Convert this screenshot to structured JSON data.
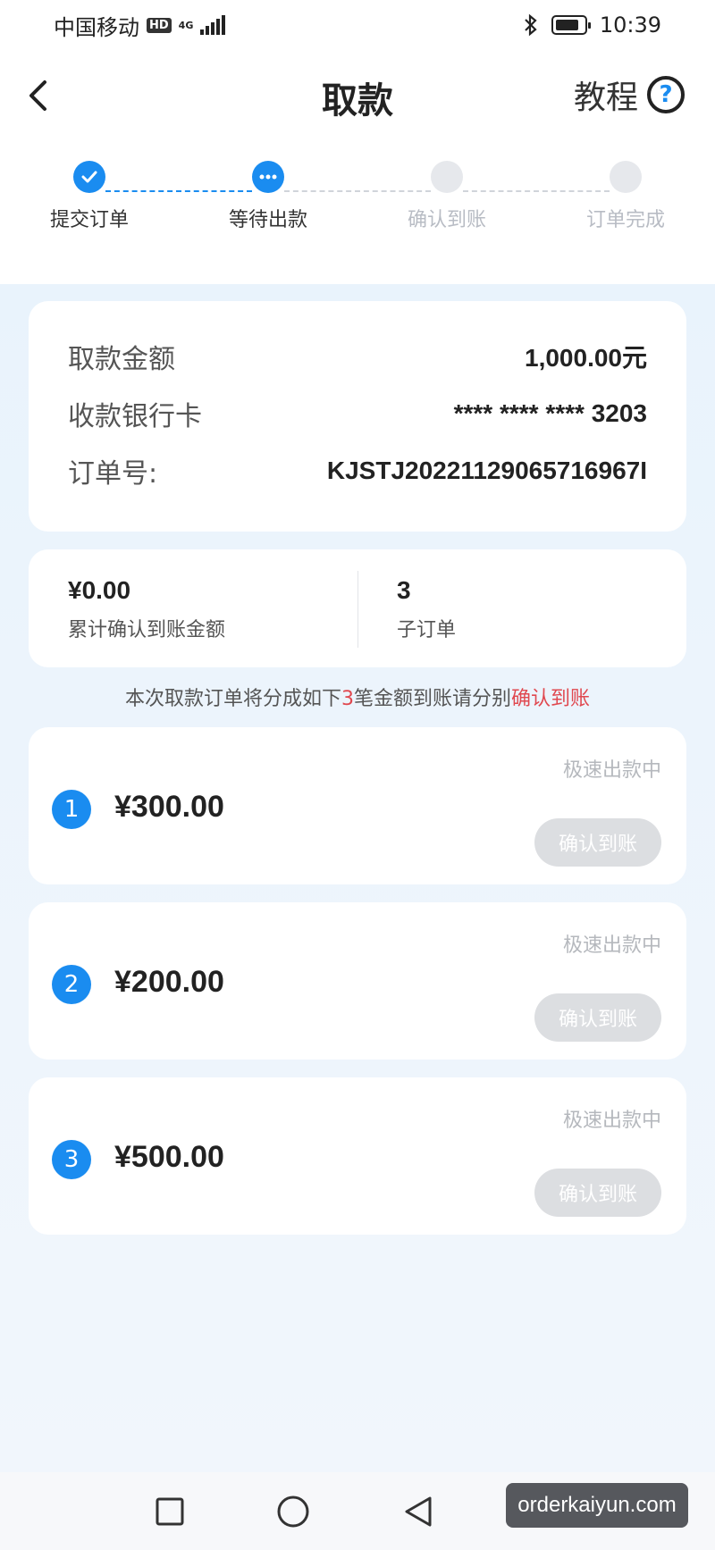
{
  "status_bar": {
    "carrier": "中国移动",
    "hd_badge": "HD",
    "network": "4G",
    "time": "10:39",
    "battery_level": 0.85
  },
  "header": {
    "title": "取款",
    "tutorial_label": "教程",
    "help_glyph": "?"
  },
  "steps": [
    {
      "label": "提交订单",
      "state": "done"
    },
    {
      "label": "等待出款",
      "state": "active"
    },
    {
      "label": "确认到账",
      "state": "todo"
    },
    {
      "label": "订单完成",
      "state": "todo"
    }
  ],
  "order_info": {
    "amount_label": "取款金额",
    "amount_value": "1,000.00元",
    "card_label": "收款银行卡",
    "card_value": "**** **** **** 3203",
    "order_no_label": "订单号:",
    "order_no_value": "KJSTJ20221129065716967I"
  },
  "stats": {
    "confirmed_value": "¥0.00",
    "confirmed_label": "累计确认到账金额",
    "suborders_value": "3",
    "suborders_label": "子订单"
  },
  "notice": {
    "prefix": "本次取款订单将分成如下",
    "count": "3",
    "middle": "笔金额到账请分别",
    "highlight": "确认到账"
  },
  "suborders": [
    {
      "index": "1",
      "amount": "¥300.00",
      "status": "极速出款中",
      "button": "确认到账"
    },
    {
      "index": "2",
      "amount": "¥200.00",
      "status": "极速出款中",
      "button": "确认到账"
    },
    {
      "index": "3",
      "amount": "¥500.00",
      "status": "极速出款中",
      "button": "确认到账"
    }
  ],
  "watermark": "orderkaiyun.com",
  "icons": {
    "back": "chevron-left-icon",
    "help": "question-circle-icon",
    "step_done": "check-icon",
    "step_active": "ellipsis-icon",
    "nav_recent": "square-icon",
    "nav_home": "circle-icon",
    "nav_back": "triangle-back-icon"
  },
  "colors": {
    "accent": "#1a8cf0",
    "highlight": "#e0484f",
    "disabled_button": "#dcdee1"
  }
}
